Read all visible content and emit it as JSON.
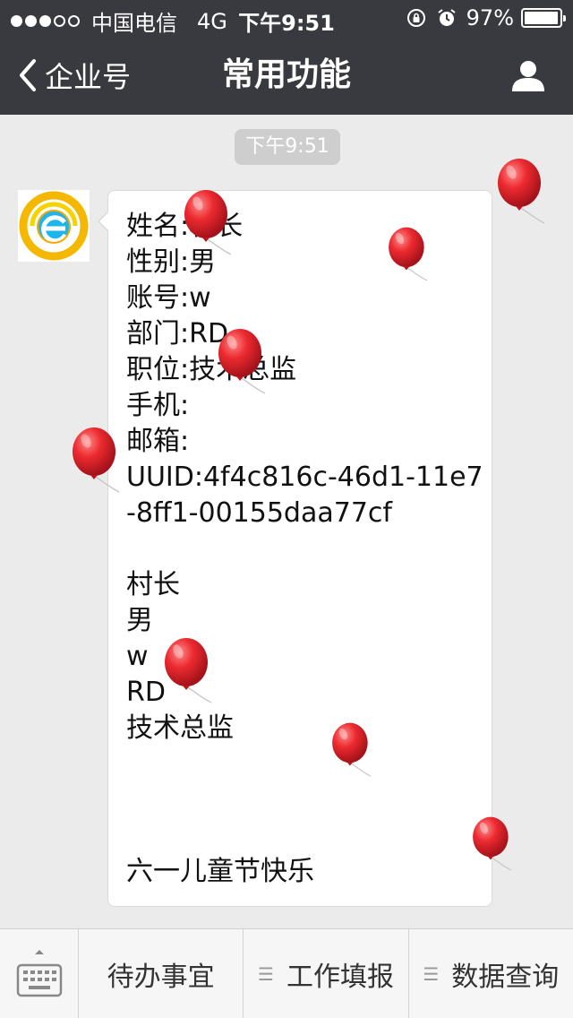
{
  "status_bar": {
    "carrier": "中国电信",
    "network": "4G",
    "time": "下午9:51",
    "battery": "97%",
    "battery_level": 0.97,
    "signal_bars_filled": 3,
    "signal_bars_total": 5
  },
  "nav": {
    "back_label": "企业号",
    "title": "常用功能",
    "user_icon": "person-icon"
  },
  "chat": {
    "timestamp": "下午9:51",
    "message_lines": [
      "姓名:村长",
      "性别:男",
      "账号:w",
      "部门:RD",
      "职位:技术总监",
      "手机:",
      "邮箱:",
      "UUID:4f4c816c-46d1-11e7",
      "-8ff1-00155daa77cf",
      "",
      "村长",
      "男",
      "w",
      "RD",
      "技术总监",
      "",
      "",
      "",
      "六一儿童节快乐"
    ]
  },
  "menu": {
    "keyboard_icon": "keyboard-icon",
    "items": [
      {
        "label": "待办事宜",
        "has_submenu": false
      },
      {
        "label": "工作填报",
        "has_submenu": true
      },
      {
        "label": "数据查询",
        "has_submenu": true
      }
    ]
  },
  "colors": {
    "header_bg": "#393a3f",
    "chat_bg": "#ebebeb",
    "balloon": "#e8262d"
  }
}
